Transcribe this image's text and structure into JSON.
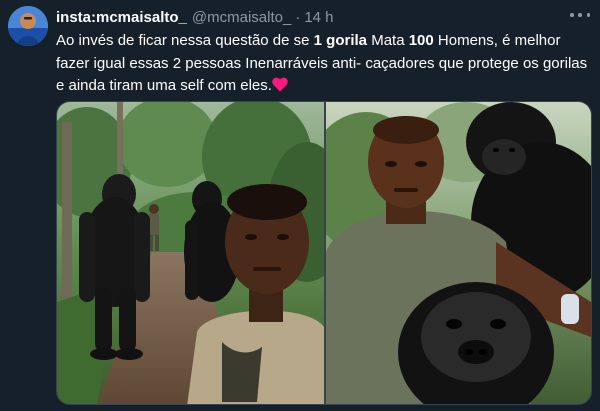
{
  "tweet": {
    "display_name": "insta:mcmaisalto_",
    "handle": "@mcmaisalto_",
    "separator": "·",
    "timestamp": "14 h",
    "text_parts": {
      "p1": "Ao invés de ficar nessa questão de se ",
      "b1": "1 gorila",
      "p2": " Mata ",
      "b2": "100",
      "p3": " Homens, é melhor fazer igual essas 2 pessoas Inenarráveis anti- caçadores que protege os gorilas e ainda tiram uma self com eles."
    },
    "emoji": "heart-emoji"
  },
  "media": {
    "photos": [
      {
        "name": "photo-gorillas-standing-forest-selfie"
      },
      {
        "name": "photo-gorillas-ranger-selfie-closeup"
      }
    ]
  },
  "colors": {
    "background": "#15202b",
    "text": "#ffffff",
    "muted": "#8b98a5",
    "border": "#38444d",
    "heart": "#f91880"
  },
  "icons": {
    "more": "more-options-icon",
    "avatar": "avatar"
  }
}
